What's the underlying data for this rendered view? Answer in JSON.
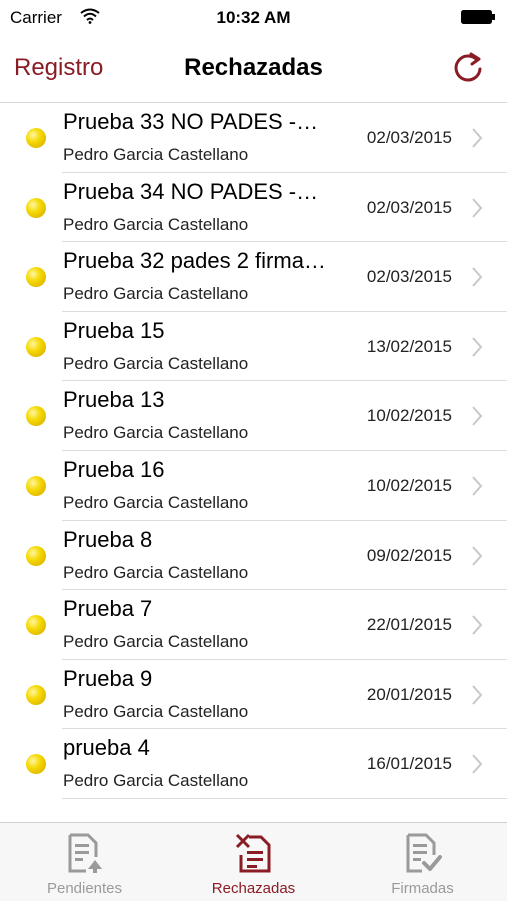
{
  "status": {
    "carrier": "Carrier",
    "time": "10:32 AM"
  },
  "nav": {
    "back_label": "Registro",
    "title": "Rechazadas"
  },
  "rows": [
    {
      "title": "Prueba 33 NO PADES -…",
      "subtitle": "Pedro Garcia Castellano",
      "date": "02/03/2015"
    },
    {
      "title": "Prueba 34 NO PADES -…",
      "subtitle": "Pedro Garcia Castellano",
      "date": "02/03/2015"
    },
    {
      "title": "Prueba 32 pades 2 firma…",
      "subtitle": "Pedro Garcia Castellano",
      "date": "02/03/2015"
    },
    {
      "title": "Prueba 15",
      "subtitle": "Pedro Garcia Castellano",
      "date": "13/02/2015"
    },
    {
      "title": "Prueba 13",
      "subtitle": "Pedro Garcia Castellano",
      "date": "10/02/2015"
    },
    {
      "title": "Prueba 16",
      "subtitle": "Pedro Garcia Castellano",
      "date": "10/02/2015"
    },
    {
      "title": "Prueba 8",
      "subtitle": "Pedro Garcia Castellano",
      "date": "09/02/2015"
    },
    {
      "title": "Prueba 7",
      "subtitle": "Pedro Garcia Castellano",
      "date": "22/01/2015"
    },
    {
      "title": "Prueba 9",
      "subtitle": "Pedro Garcia Castellano",
      "date": "20/01/2015"
    },
    {
      "title": "prueba 4",
      "subtitle": "Pedro Garcia Castellano",
      "date": "16/01/2015"
    }
  ],
  "tabs": [
    {
      "label": "Pendientes",
      "icon": "document-upload-icon",
      "active": false
    },
    {
      "label": "Rechazadas",
      "icon": "document-reject-icon",
      "active": true
    },
    {
      "label": "Firmadas",
      "icon": "document-signed-icon",
      "active": false
    }
  ],
  "colors": {
    "accent": "#8a1c25",
    "inactive": "#9a9a9a",
    "status_dot": "#f5d800"
  }
}
